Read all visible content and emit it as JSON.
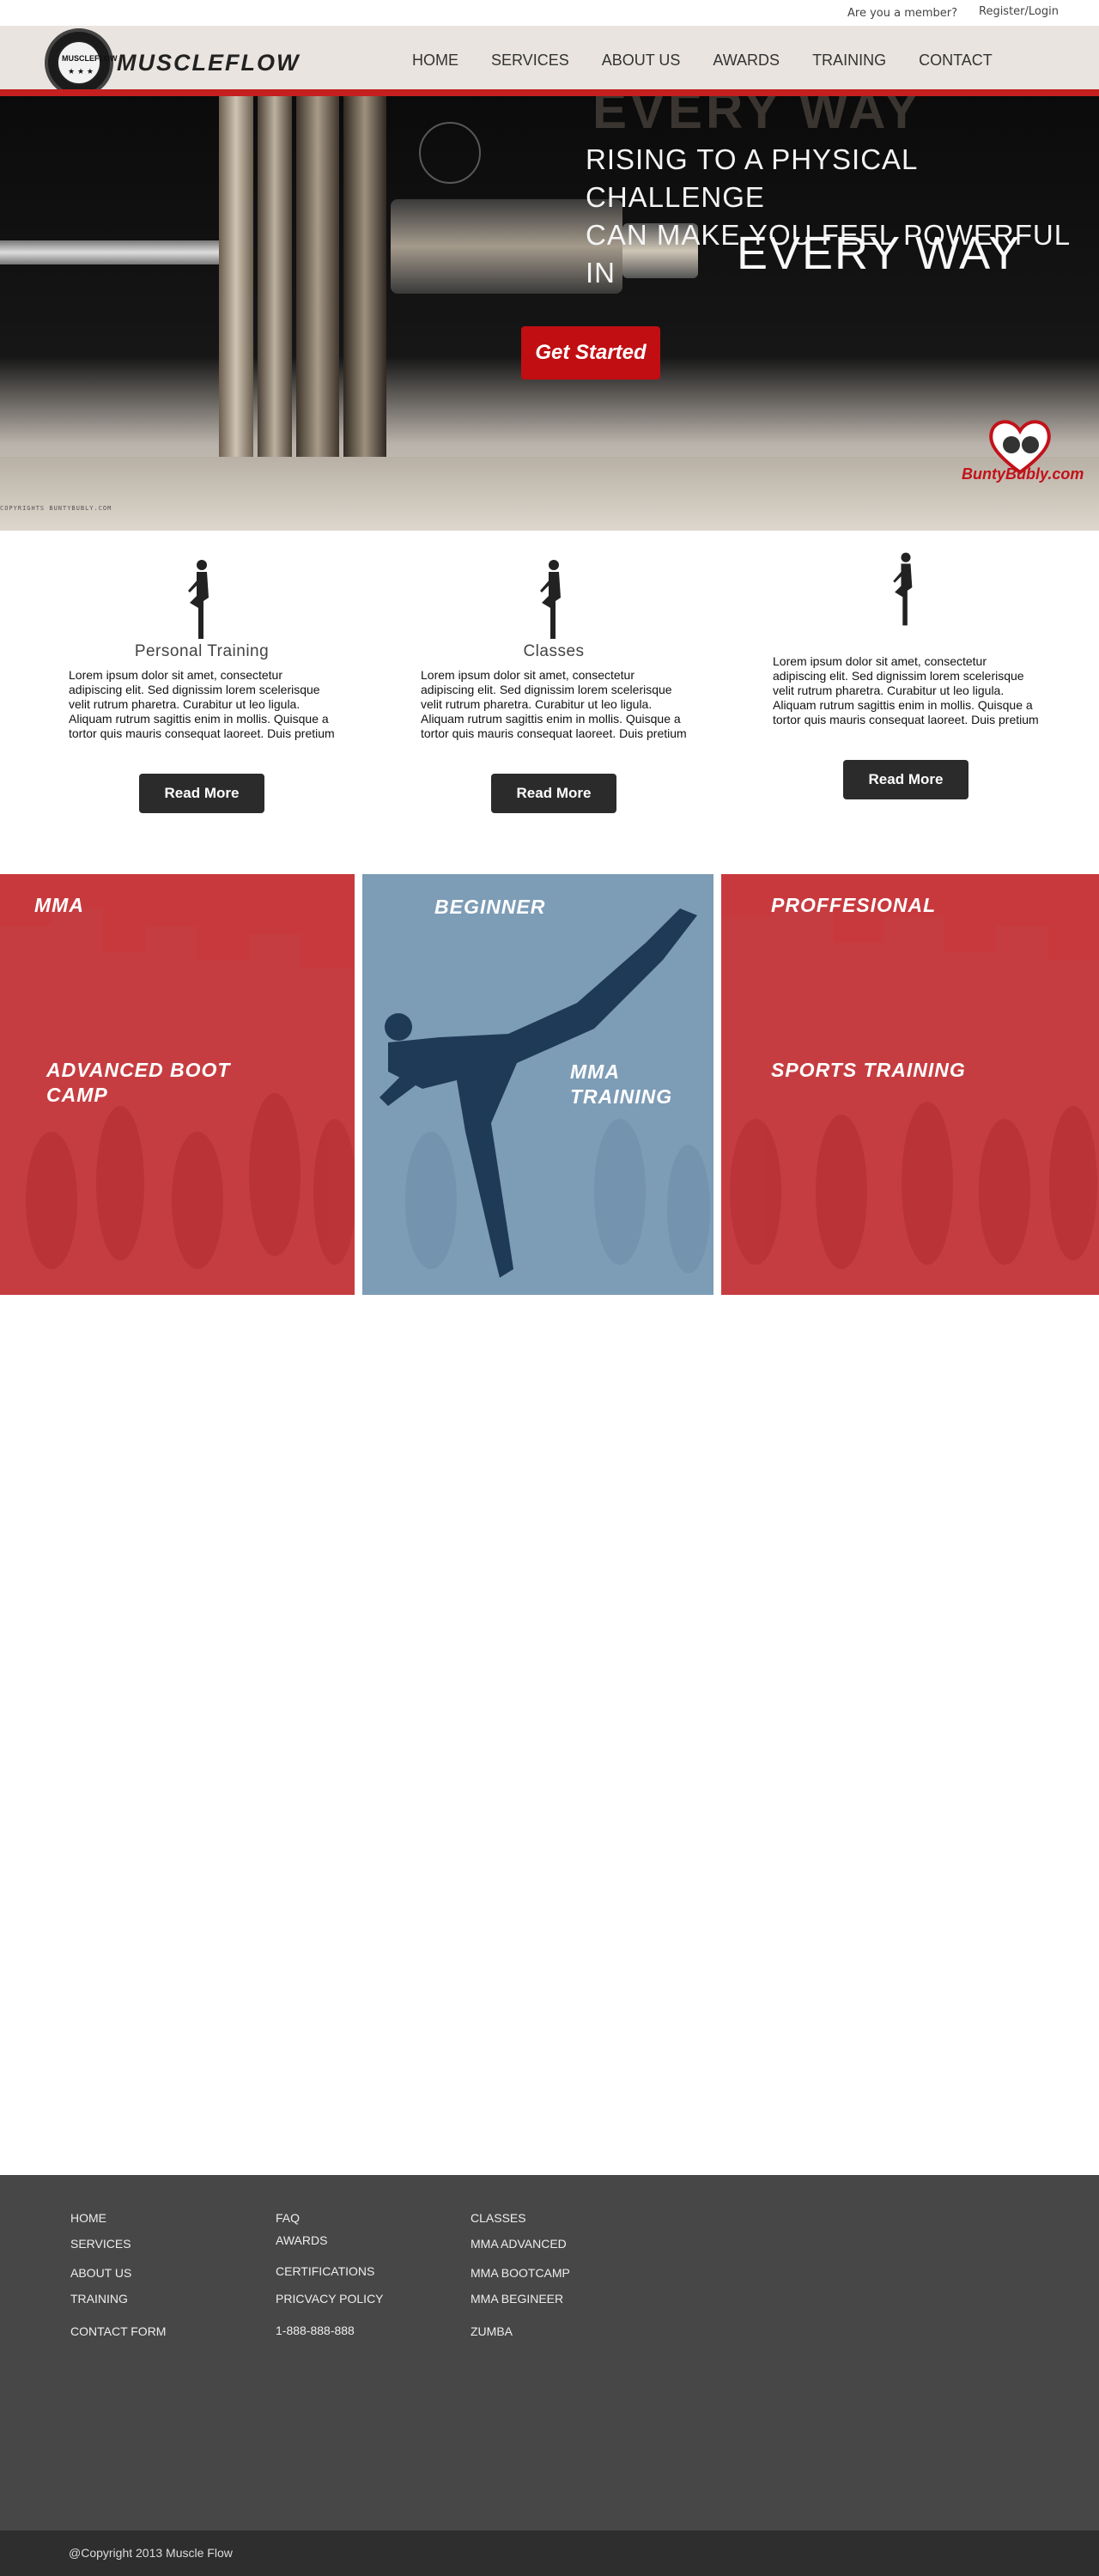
{
  "topbar": {
    "member_text": "Are you a member?",
    "login_label": "Register/Login"
  },
  "brand": {
    "name": "MUSCLEFLOW",
    "logo_text": "MUSCLEFLOW",
    "logo_stars": "★ ★ ★"
  },
  "nav": [
    "HOME",
    "SERVICES",
    "ABOUT US",
    "AWARDS",
    "TRAINING",
    "CONTACT"
  ],
  "hero": {
    "ghost_text": "EVERY WAY",
    "headline_line1": "RISING TO A PHYSICAL CHALLENGE",
    "headline_line2": "CAN MAKE YOU FEEL POWERFUL IN",
    "headline_big": "EVERY WAY",
    "cta_label": "Get Started",
    "watermark": "BuntyBubly.com",
    "copyright_strip": "COPYRIGHTS BUNTYBUBLY.COM"
  },
  "services": [
    {
      "title": "Personal Training",
      "body": "Lorem ipsum dolor sit amet, consectetur adipiscing elit. Sed dignissim lorem scelerisque velit rutrum pharetra. Curabitur ut leo ligula. Aliquam rutrum sagittis enim in mollis. Quisque a tortor quis mauris consequat laoreet. Duis pretium",
      "button": "Read More"
    },
    {
      "title": "Classes",
      "body": "Lorem ipsum dolor sit amet, consectetur adipiscing elit. Sed dignissim lorem scelerisque velit rutrum pharetra. Curabitur ut leo ligula. Aliquam rutrum sagittis enim in mollis. Quisque a tortor quis mauris consequat laoreet. Duis pretium",
      "button": "Read More"
    },
    {
      "title": "",
      "body": "Lorem ipsum dolor sit amet, consectetur adipiscing elit. Sed dignissim lorem scelerisque velit rutrum pharetra. Curabitur ut leo ligula. Aliquam rutrum sagittis enim in mollis. Quisque a tortor quis mauris consequat laoreet. Duis pretium",
      "button": "Read More"
    }
  ],
  "tiles": {
    "t1_top": "MMA",
    "t1_bottom": "ADVANCED BOOT CAMP",
    "t2_top": "BEGINNER",
    "t2_bottom": "MMA TRAINING",
    "t3_top": "PROFFESIONAL",
    "t3_bottom": "SPORTS TRAINING"
  },
  "footer": {
    "col1": [
      "HOME",
      "SERVICES",
      "ABOUT US",
      "TRAINING",
      "CONTACT FORM"
    ],
    "col2": [
      "FAQ",
      "AWARDS",
      "CERTIFICATIONS",
      "PRICVACY POLICY",
      "1-888-888-888"
    ],
    "col3": [
      "CLASSES",
      "MMA ADVANCED",
      "MMA BOOTCAMP",
      "MMA BEGINEER",
      "ZUMBA"
    ]
  },
  "copyright": "@Copyright 2013 Muscle Flow",
  "colors": {
    "accent_red": "#c10e12",
    "tile_red": "#c8393d",
    "tile_blue": "#7d9cb6",
    "footer_bg": "#474747"
  }
}
